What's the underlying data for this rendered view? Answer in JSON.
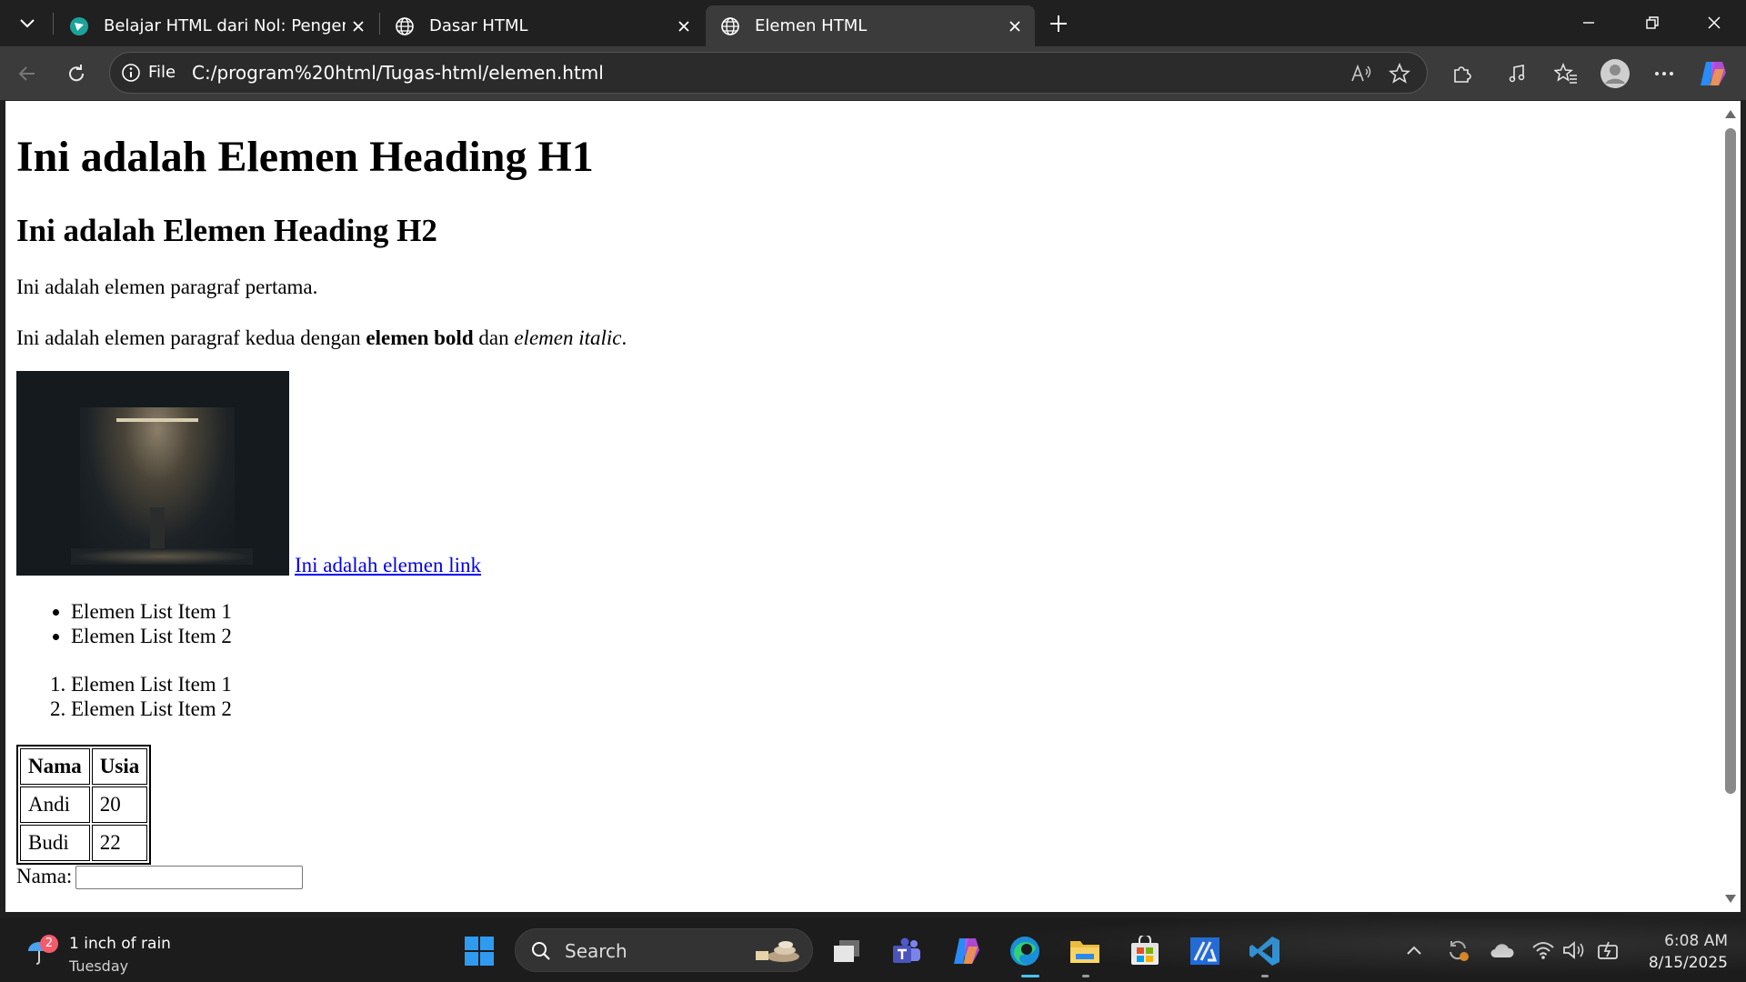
{
  "browser": {
    "tabs": [
      {
        "title": "Belajar HTML dari Nol: Pengenalan",
        "favicon": "site-logo-icon",
        "active": false
      },
      {
        "title": "Dasar HTML",
        "favicon": "globe-icon",
        "active": false
      },
      {
        "title": "Elemen HTML",
        "favicon": "globe-icon",
        "active": true
      }
    ],
    "address": {
      "scheme_label": "File",
      "url": "C:/program%20html/Tugas-html/elemen.html"
    }
  },
  "page": {
    "h1": "Ini adalah Elemen Heading H1",
    "h2": "Ini adalah Elemen Heading H2",
    "p1": "Ini adalah elemen paragraf pertama.",
    "p2": {
      "pre": "Ini adalah elemen paragraf kedua dengan ",
      "bold": "elemen bold",
      "mid": " dan ",
      "italic": "elemen italic",
      "post": "."
    },
    "link": "Ini adalah elemen link",
    "ul": [
      "Elemen List Item 1",
      "Elemen List Item 2"
    ],
    "ol": [
      "Elemen List Item 1",
      "Elemen List Item 2"
    ],
    "table": {
      "headers": [
        "Nama",
        "Usia"
      ],
      "rows": [
        [
          "Andi",
          "20"
        ],
        [
          "Budi",
          "22"
        ]
      ]
    },
    "form": {
      "label": "Nama:",
      "value": ""
    }
  },
  "taskbar": {
    "weather": {
      "text": "1 inch of rain",
      "day": "Tuesday",
      "badge": "2"
    },
    "search_label": "Search",
    "time": "6:08 AM",
    "date": "8/15/2025"
  },
  "colors": {
    "accent": "#0078d4",
    "link": "#0000ee",
    "chrome_dark": "#202020",
    "chrome_mid": "#3b3b3b"
  }
}
